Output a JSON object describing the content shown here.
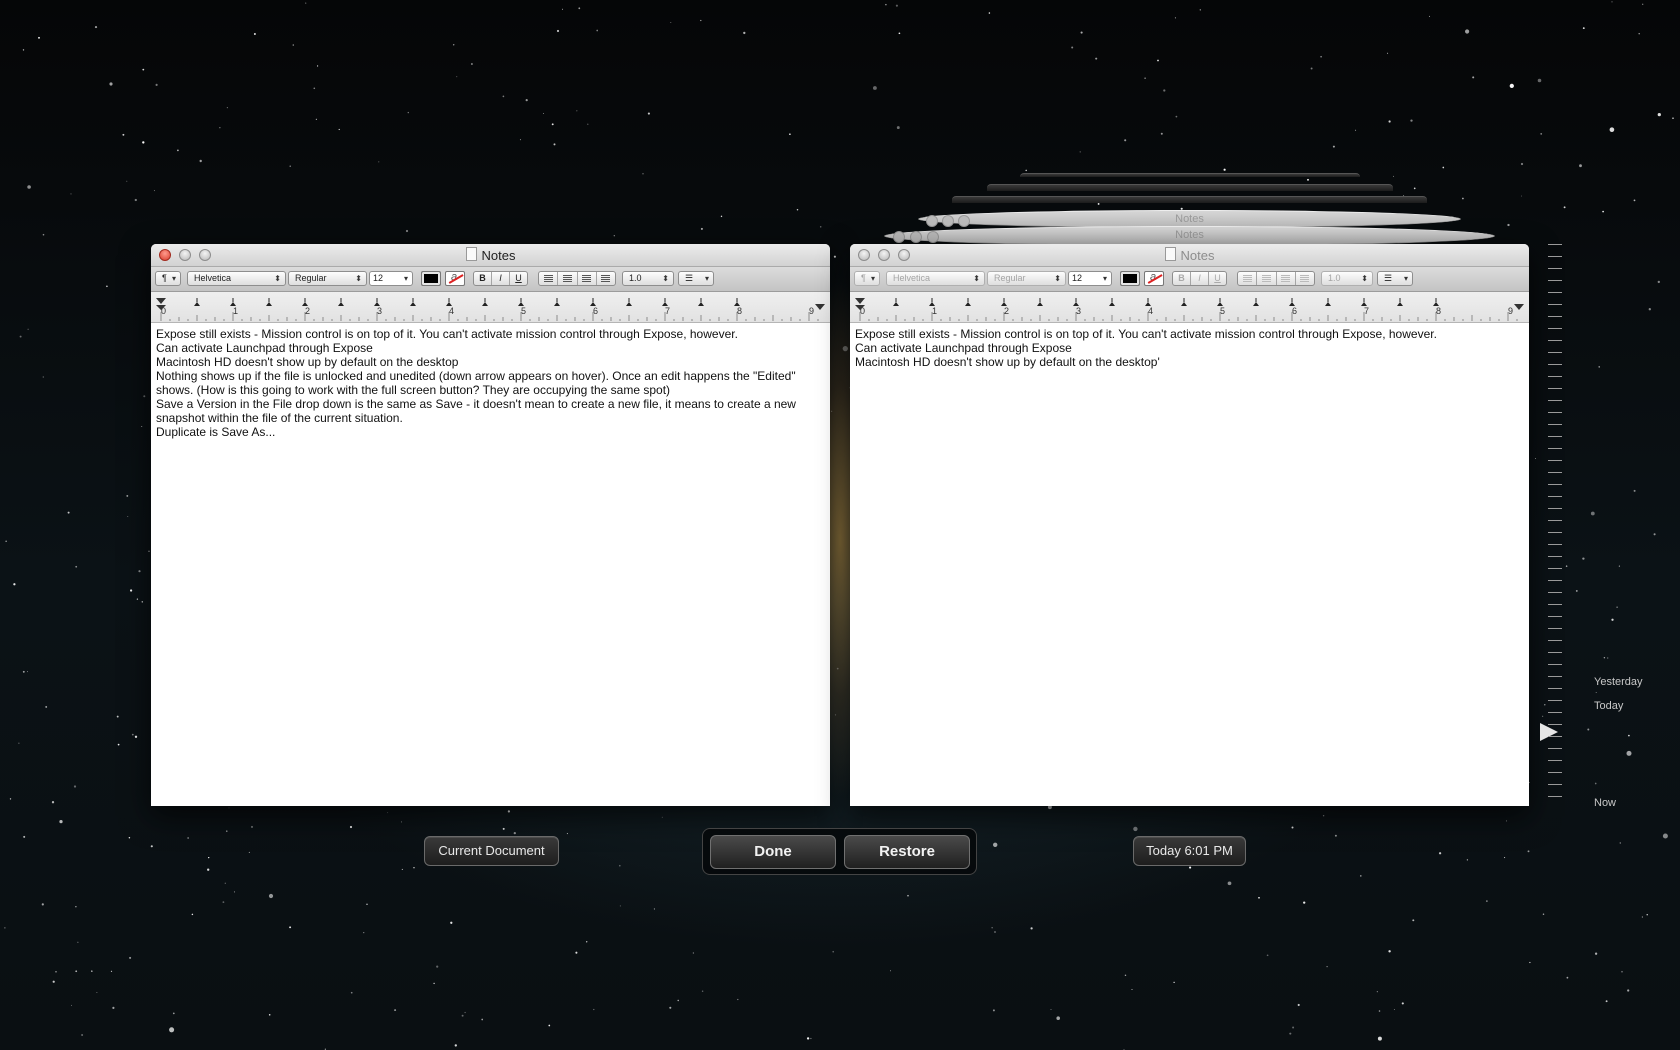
{
  "window_title": "Notes",
  "toolbar": {
    "paragraph_style": "¶",
    "font_family": "Helvetica",
    "font_style": "Regular",
    "font_size": "12",
    "bold": "B",
    "italic": "I",
    "underline": "U",
    "line_spacing": "1.0",
    "highlight_glyph": "a"
  },
  "ruler_numbers": [
    "0",
    "1",
    "2",
    "3",
    "4",
    "5",
    "6",
    "7",
    "8",
    "9"
  ],
  "current_doc": {
    "lines": [
      "Expose still exists - Mission control is on top of it. You can't activate mission control through Expose, however.",
      "Can activate Launchpad through Expose",
      "Macintosh HD doesn't show up by default on the desktop",
      "Nothing shows up if the file is unlocked and unedited (down arrow appears on hover). Once an edit happens the \"Edited\" shows. (How is this going to work with the full screen button? They are occupying the same spot)",
      "Save a Version in the File drop down is the same as Save - it doesn't mean to create a new file, it means to create a new snapshot within the file of the current situation.",
      "Duplicate is Save As..."
    ]
  },
  "version_doc": {
    "lines": [
      "Expose still exists - Mission control is on top of it. You can't activate mission control through Expose, however.",
      "Can activate Launchpad through Expose",
      "Macintosh HD doesn't show up by default on the desktop'"
    ]
  },
  "labels": {
    "current_document": "Current Document",
    "version_time": "Today 6:01 PM",
    "done": "Done",
    "restore": "Restore"
  },
  "timeline": {
    "yesterday": "Yesterday",
    "today": "Today",
    "now": "Now"
  }
}
